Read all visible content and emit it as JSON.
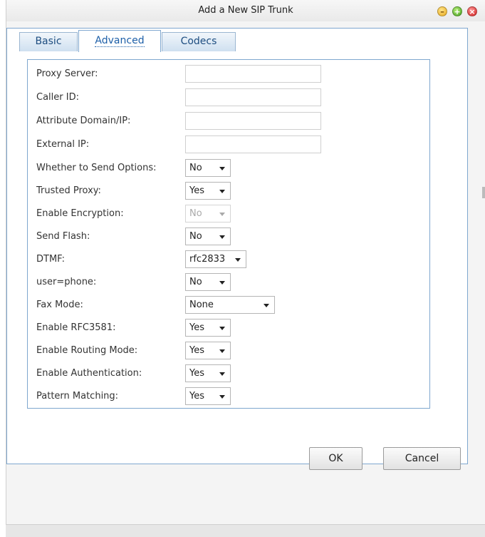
{
  "window": {
    "title": "Add a New SIP Trunk"
  },
  "tabs": [
    {
      "label": "Basic"
    },
    {
      "label": "Advanced"
    },
    {
      "label": "Codecs"
    }
  ],
  "fields": {
    "proxy_server": {
      "label": "Proxy Server:",
      "value": ""
    },
    "caller_id": {
      "label": "Caller ID:",
      "value": ""
    },
    "attribute_domain": {
      "label": "Attribute Domain/IP:",
      "value": ""
    },
    "external_ip": {
      "label": "External IP:",
      "value": ""
    },
    "send_options": {
      "label": "Whether to Send Options:",
      "value": "No"
    },
    "trusted_proxy": {
      "label": "Trusted Proxy:",
      "value": "Yes"
    },
    "enable_encryption": {
      "label": "Enable Encryption:",
      "value": "No"
    },
    "send_flash": {
      "label": "Send Flash:",
      "value": "No"
    },
    "dtmf": {
      "label": "DTMF:",
      "value": "rfc2833"
    },
    "user_phone": {
      "label": "user=phone:",
      "value": "No"
    },
    "fax_mode": {
      "label": "Fax Mode:",
      "value": "None"
    },
    "enable_rfc3581": {
      "label": "Enable RFC3581:",
      "value": "Yes"
    },
    "enable_routing_mode": {
      "label": "Enable Routing Mode:",
      "value": "Yes"
    },
    "enable_authentication": {
      "label": "Enable Authentication:",
      "value": "Yes"
    },
    "pattern_matching": {
      "label": "Pattern Matching:",
      "value": "Yes"
    }
  },
  "buttons": {
    "ok": "OK",
    "cancel": "Cancel"
  },
  "colors": {
    "accent_border": "#7fa7cf",
    "tab_text": "#1d4d80"
  },
  "icons": [
    "minimize-icon",
    "maximize-icon",
    "close-icon",
    "chevron-down-icon"
  ]
}
